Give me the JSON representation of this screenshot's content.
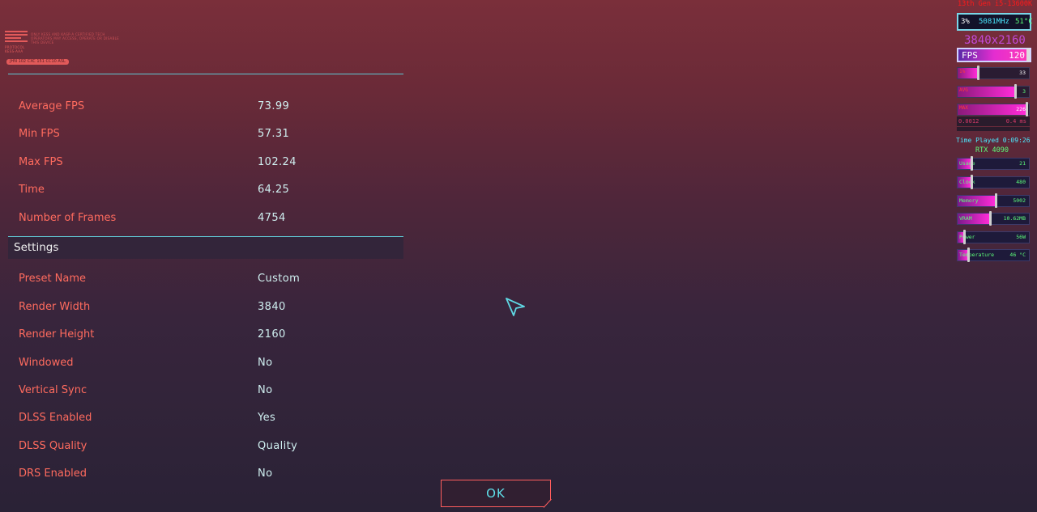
{
  "logo": {
    "caption": "PROTOCOL\nKESS-AAA",
    "description": "ONLY KESS AND KASP-A CERTIFIED TECH OPERATORS MAY ACCESS, OPERATE OR DISABLE THIS DEVICE",
    "tag": "JHN 102 CXC 151 CC10 ASL"
  },
  "results": [
    {
      "label": "Average FPS",
      "value": "73.99"
    },
    {
      "label": "Min FPS",
      "value": "57.31"
    },
    {
      "label": "Max FPS",
      "value": "102.24"
    },
    {
      "label": "Time",
      "value": "64.25"
    },
    {
      "label": "Number of Frames",
      "value": "4754"
    }
  ],
  "settings_header": "Settings",
  "settings": [
    {
      "label": "Preset Name",
      "value": "Custom"
    },
    {
      "label": "Render Width",
      "value": "3840"
    },
    {
      "label": "Render Height",
      "value": "2160"
    },
    {
      "label": "Windowed",
      "value": "No"
    },
    {
      "label": "Vertical Sync",
      "value": "No"
    },
    {
      "label": "DLSS Enabled",
      "value": "Yes"
    },
    {
      "label": "DLSS Quality",
      "value": "Quality"
    },
    {
      "label": "DRS Enabled",
      "value": "No"
    }
  ],
  "ok_button": "OK",
  "colors": {
    "label": "#ff6b5e",
    "value": "#cfeff0",
    "accent": "#5fc8d4",
    "button_border": "#ff5d5d"
  },
  "overlay": {
    "cpu_title": "13th Gen i5-13600K",
    "cpu_usage": "3%",
    "cpu_clock": "5081MHz",
    "cpu_temp": "51°C",
    "resolution": "3840x2160",
    "fps_label": "FPS",
    "fps_value": "120",
    "fps_level": 1.0,
    "bars": [
      {
        "label": "1%",
        "value": "33",
        "level": 0.27,
        "label_color": "#ff3a3a",
        "value_color": "#ffffff"
      },
      {
        "label": "AVG",
        "value": "3",
        "level": 0.8,
        "label_color": "#ff3a3a",
        "value_color": "#5dff7a"
      },
      {
        "label": "MAX",
        "value": "226",
        "level": 0.95,
        "label_color": "#ff3a3a",
        "value_color": "#ffffff"
      }
    ],
    "frametime_left": "0.0012",
    "frametime_right": "0.4 ms",
    "time_played": "Time Played 0:09:26",
    "gpu_name": "RTX 4090",
    "gpu_bars": [
      {
        "label": "Usage",
        "value": "21",
        "level": 0.18
      },
      {
        "label": "Clock",
        "value": "480",
        "level": 0.18
      },
      {
        "label": "Memory",
        "value": "5002",
        "level": 0.52
      },
      {
        "label": "VRAM",
        "value": "10.62MB",
        "level": 0.44
      },
      {
        "label": "Power",
        "value": "56W",
        "level": 0.08
      },
      {
        "label": "Temperature",
        "value": "46 °C",
        "level": 0.14
      }
    ]
  }
}
